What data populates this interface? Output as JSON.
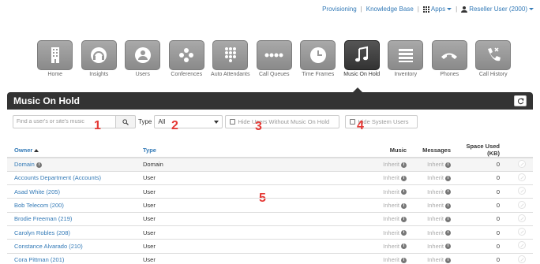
{
  "topbar": {
    "provisioning": "Provisioning",
    "knowledge_base": "Knowledge Base",
    "apps": "Apps",
    "user": "Reseller User (2000)",
    "separator": "|"
  },
  "nav": {
    "home": "Home",
    "insights": "Insights",
    "users": "Users",
    "conferences": "Conferences",
    "auto_attendants": "Auto Attendants",
    "call_queues": "Call Queues",
    "time_frames": "Time Frames",
    "music_on_hold": "Music On Hold",
    "inventory": "Inventory",
    "phones": "Phones",
    "call_history": "Call History"
  },
  "header": {
    "title": "Music On Hold"
  },
  "filters": {
    "search_placeholder": "Find a user's or site's music",
    "type_label": "Type",
    "type_value": "All",
    "hide_users_without_music": "Hide Users Without Music On Hold",
    "hide_system_users": "Hide System Users"
  },
  "annotations": {
    "a1": "1",
    "a2": "2",
    "a3": "3",
    "a4": "4",
    "a5": "5"
  },
  "table": {
    "headers": {
      "owner": "Owner",
      "type": "Type",
      "music": "Music",
      "messages": "Messages",
      "space": "Space Used (KB)"
    },
    "rows": [
      {
        "owner": "Domain",
        "type": "Domain",
        "music": "Inherit",
        "messages": "Inherit",
        "space": "0"
      },
      {
        "owner": "Accounts Department (Accounts)",
        "type": "User",
        "music": "Inherit",
        "messages": "Inherit",
        "space": "0"
      },
      {
        "owner": "Asad White (205)",
        "type": "User",
        "music": "Inherit",
        "messages": "Inherit",
        "space": "0"
      },
      {
        "owner": "Bob Telecom (200)",
        "type": "User",
        "music": "Inherit",
        "messages": "Inherit",
        "space": "0"
      },
      {
        "owner": "Brodie Freeman (219)",
        "type": "User",
        "music": "Inherit",
        "messages": "Inherit",
        "space": "0"
      },
      {
        "owner": "Carolyn Robles (208)",
        "type": "User",
        "music": "Inherit",
        "messages": "Inherit",
        "space": "0"
      },
      {
        "owner": "Constance Alvarado (210)",
        "type": "User",
        "music": "Inherit",
        "messages": "Inherit",
        "space": "0"
      },
      {
        "owner": "Cora Pittman (201)",
        "type": "User",
        "music": "Inherit",
        "messages": "Inherit",
        "space": "0"
      }
    ]
  },
  "colors": {
    "link": "#337ab7",
    "header_bg": "#333333",
    "annotation": "#e53935"
  }
}
